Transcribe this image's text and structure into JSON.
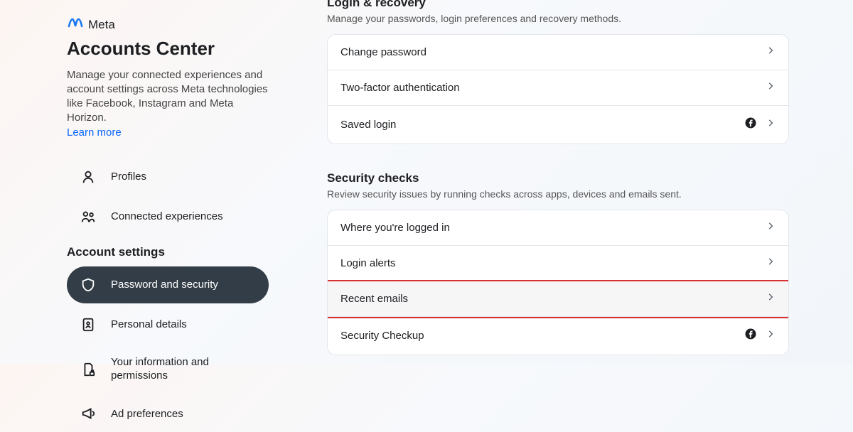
{
  "brand": {
    "name": "Meta"
  },
  "sidebar": {
    "title": "Accounts Center",
    "description": "Manage your connected experiences and account settings across Meta technologies like Facebook, Instagram and Meta Horizon.",
    "learn_more": "Learn more",
    "items": {
      "profiles": "Profiles",
      "connected": "Connected experiences"
    },
    "section_header": "Account settings",
    "settings": {
      "password": "Password and security",
      "personal": "Personal details",
      "info_perms": "Your information and permissions",
      "ad_prefs": "Ad preferences"
    }
  },
  "sections": {
    "login": {
      "title": "Login & recovery",
      "desc": "Manage your passwords, login preferences and recovery methods.",
      "rows": {
        "change_pw": "Change password",
        "two_factor": "Two-factor authentication",
        "saved_login": "Saved login"
      }
    },
    "security": {
      "title": "Security checks",
      "desc": "Review security issues by running checks across apps, devices and emails sent.",
      "rows": {
        "where_logged": "Where you're logged in",
        "login_alerts": "Login alerts",
        "recent_emails": "Recent emails",
        "security_checkup": "Security Checkup"
      }
    }
  }
}
